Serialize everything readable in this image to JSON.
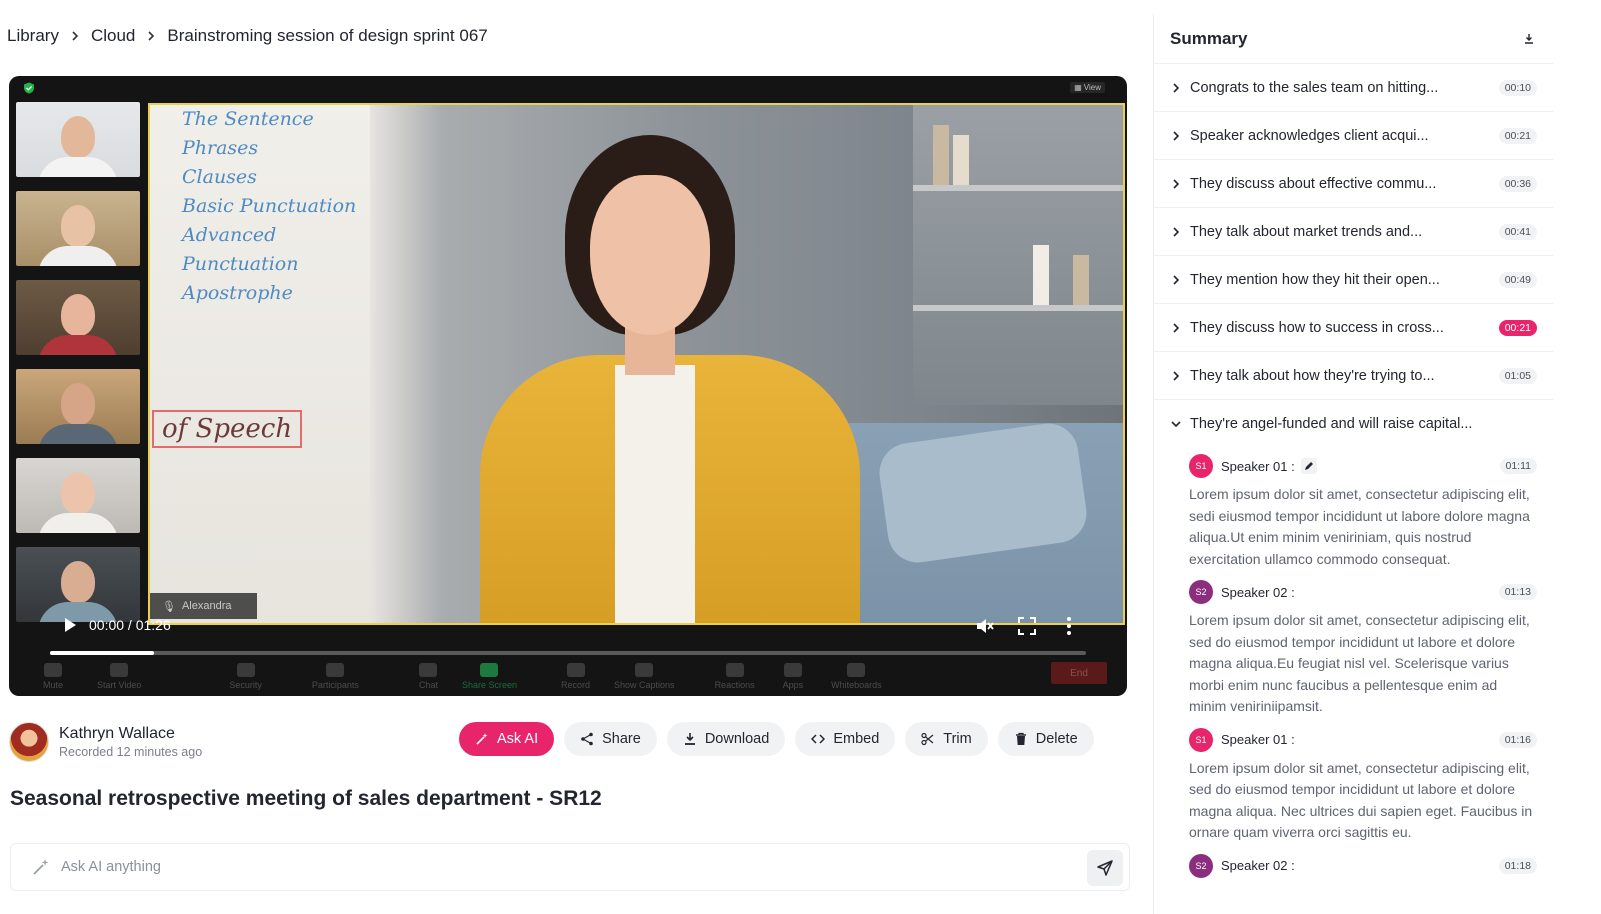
{
  "breadcrumb": [
    "Library",
    "Cloud",
    "Brainstroming session of design sprint 067"
  ],
  "video": {
    "view_label": "View",
    "participant_label": "Alexandra",
    "time": "00:00 / 01:26",
    "progress_fraction": 0.1,
    "board_lines": [
      "The Sentence",
      "Phrases",
      "Clauses",
      "Basic Punctuation",
      "Advanced Punctuation",
      "Apostrophe"
    ],
    "board_speech": "of Speech",
    "toolbar": [
      {
        "label": "Mute",
        "icon": "mic-icon"
      },
      {
        "label": "Start Video",
        "icon": "video-icon"
      },
      {
        "label": "Security",
        "icon": "shield-icon"
      },
      {
        "label": "Participants",
        "icon": "participants-icon"
      },
      {
        "label": "Chat",
        "icon": "chat-icon"
      },
      {
        "label": "Share Screen",
        "icon": "share-screen-icon"
      },
      {
        "label": "Record",
        "icon": "record-icon"
      },
      {
        "label": "Show Captions",
        "icon": "captions-icon"
      },
      {
        "label": "Reactions",
        "icon": "reactions-icon"
      },
      {
        "label": "Apps",
        "icon": "apps-icon"
      },
      {
        "label": "Whiteboards",
        "icon": "whiteboard-icon"
      }
    ],
    "end_label": "End"
  },
  "user": {
    "name": "Kathryn Wallace",
    "subtitle": "Recorded 12 minutes ago"
  },
  "actions": {
    "ask_ai": "Ask AI",
    "share": "Share",
    "download": "Download",
    "embed": "Embed",
    "trim": "Trim",
    "delete": "Delete"
  },
  "meeting_title": "Seasonal retrospective meeting of sales department - SR12",
  "ask": {
    "placeholder": "Ask AI anything"
  },
  "summary": {
    "title": "Summary",
    "items": [
      {
        "text": "Congrats to the sales team on hitting...",
        "time": "00:10"
      },
      {
        "text": "Speaker acknowledges client acqui...",
        "time": "00:21"
      },
      {
        "text": "They discuss about effective commu...",
        "time": "00:36"
      },
      {
        "text": "They talk about market trends and...",
        "time": "00:41"
      },
      {
        "text": "They mention how they hit their open...",
        "time": "00:49"
      },
      {
        "text": "They discuss how to success in cross...",
        "time": "00:21"
      },
      {
        "text": "They talk about how they're trying to...",
        "time": "01:05"
      }
    ],
    "expanded": {
      "text": "They're angel-funded and will raise capital...",
      "entries": [
        {
          "badge": "S1",
          "speaker": "Speaker 01 :",
          "time": "01:11",
          "text": "Lorem ipsum dolor sit amet, consectetur adipiscing elit, sedi eiusmod tempor incididunt ut labore dolore magna aliqua.Ut enim minim veniriniam, quis nostrud exercitation ullamco  commodo consequat."
        },
        {
          "badge": "S2",
          "speaker": "Speaker 02 :",
          "time": "01:13",
          "text": "Lorem ipsum dolor sit amet, consectetur adipiscing elit, sed do eiusmod tempor incididunt ut labore et dolore magna aliqua.Eu feugiat  nisl vel. Scelerisque varius morbi enim nunc faucibus a pellentesque enim ad minim veniriniipamsit."
        },
        {
          "badge": "S1",
          "speaker": "Speaker 01 :",
          "time": "01:16",
          "text": "Lorem ipsum dolor sit amet, consectetur adipiscing elit, sed do eiusmod tempor incididunt ut labore et dolore magna aliqua. Nec ultrices dui sapien eget. Faucibus in ornare quam viverra orci sagittis eu."
        },
        {
          "badge": "S2",
          "speaker": "Speaker 02 :",
          "time": "01:18",
          "text": ""
        }
      ]
    }
  },
  "colors": {
    "accent": "#e8246a",
    "speaker2": "#8c2e7e"
  }
}
